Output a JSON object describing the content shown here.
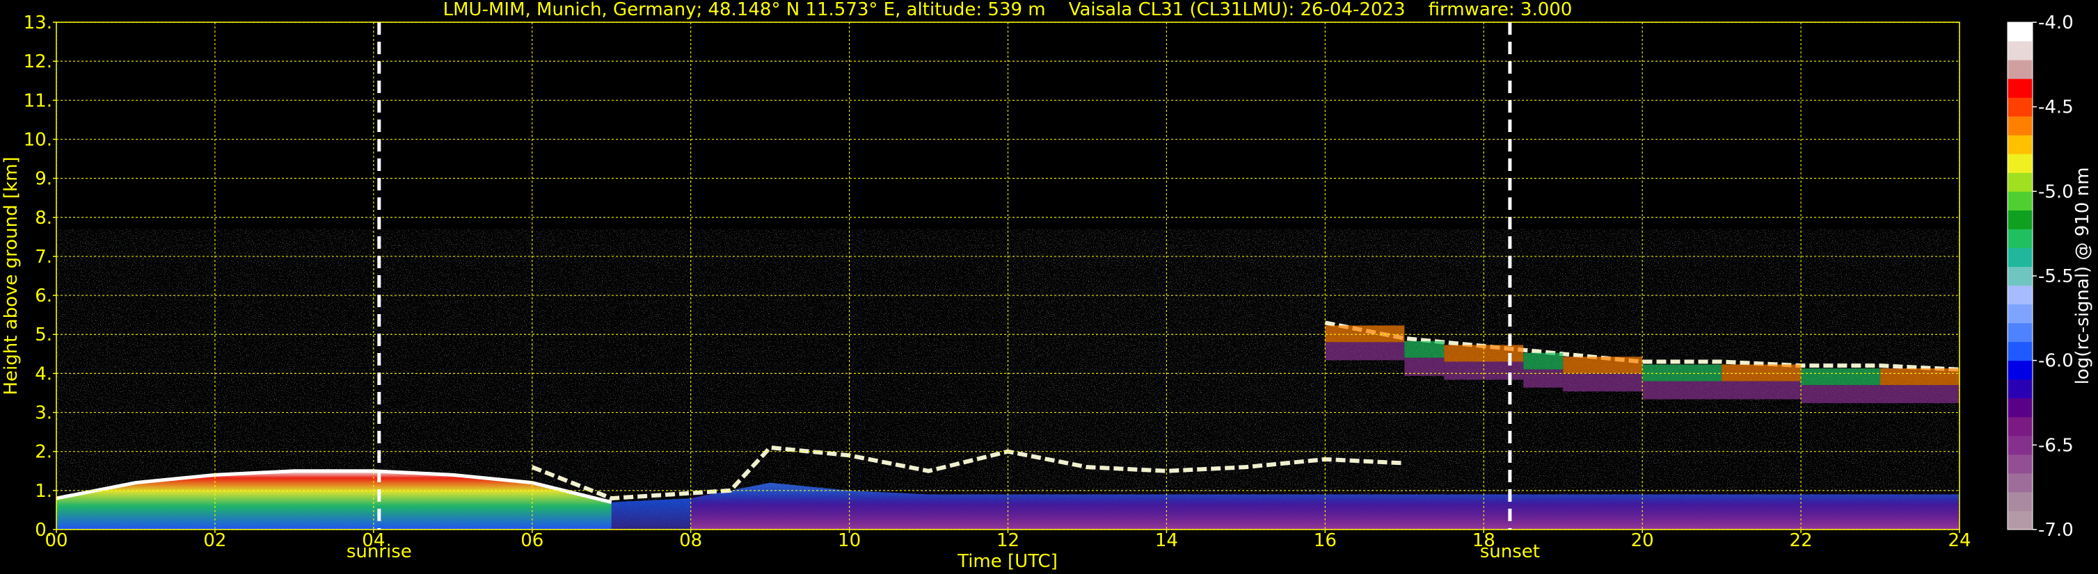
{
  "chart_data": {
    "type": "heatmap",
    "title": "LMU-MIM, Munich, Germany; 48.148° N 11.573° E, altitude: 539 m    Vaisala CL31 (CL31LMU): 26-04-2023    firmware: 3.000",
    "xlabel": "Time [UTC]",
    "ylabel": "Height above ground [km]",
    "xlim": [
      0,
      24
    ],
    "ylim": [
      0,
      13
    ],
    "x_ticks": [
      "00",
      "02",
      "04",
      "06",
      "08",
      "10",
      "12",
      "14",
      "16",
      "18",
      "20",
      "22",
      "24"
    ],
    "y_ticks": [
      "0.",
      "1.",
      "2.",
      "3.",
      "4.",
      "5.",
      "6.",
      "7.",
      "8.",
      "9.",
      "10.",
      "11.",
      "12.",
      "13."
    ],
    "grid": true,
    "events": [
      {
        "label": "sunrise",
        "time": 4.07
      },
      {
        "label": "sunset",
        "time": 18.33
      }
    ],
    "noise_top_km": 7.7,
    "colorbar": {
      "label": "log(rc-signal) @ 910 nm",
      "range": [
        -7.0,
        -4.0
      ],
      "ticks": [
        "-4.0",
        "-4.5",
        "-5.0",
        "-5.5",
        "-6.0",
        "-6.5",
        "-7.0"
      ],
      "colors": [
        "#b49aa6",
        "#aa8aa0",
        "#9e6d9a",
        "#924f94",
        "#86308e",
        "#7a1a82",
        "#5a0088",
        "#2a00b4",
        "#0000e6",
        "#1e5aff",
        "#4e82ff",
        "#7ea4ff",
        "#a6bcff",
        "#6fc5c0",
        "#1fb89c",
        "#20c060",
        "#10a020",
        "#50d030",
        "#a0e020",
        "#f0f020",
        "#ffc000",
        "#ff8000",
        "#ff4000",
        "#ff0000",
        "#d0a0a0",
        "#e8d8d8",
        "#ffffff"
      ]
    },
    "layers": [
      {
        "name": "boundary-layer aerosol",
        "x": [
          0,
          1,
          2,
          3,
          4,
          5,
          6,
          7,
          8,
          9,
          10,
          11,
          12,
          13,
          14,
          15,
          16,
          17,
          18,
          19,
          20,
          21,
          22,
          23,
          24
        ],
        "top_km": [
          0.8,
          1.2,
          1.4,
          1.5,
          1.5,
          1.4,
          1.2,
          0.7,
          0.8,
          1.2,
          1.0,
          0.9,
          0.9,
          0.9,
          0.9,
          0.9,
          0.9,
          0.9,
          0.9,
          0.9,
          0.9,
          0.9,
          0.9,
          0.9,
          0.9
        ]
      },
      {
        "name": "low cloud",
        "x": [
          6.0,
          7.0,
          8.5,
          9.0,
          10.0,
          11.0,
          12.0,
          13.0,
          14.0,
          15.0,
          16.0,
          17.0
        ],
        "top_km": [
          1.6,
          0.8,
          1.0,
          2.1,
          1.9,
          1.5,
          2.0,
          1.6,
          1.5,
          1.6,
          1.8,
          1.7
        ]
      },
      {
        "name": "mid cloud",
        "x": [
          16.0,
          17.0,
          17.5,
          18.5,
          19.0,
          20.0,
          21.0,
          22.0,
          23.0,
          24.0
        ],
        "top_km": [
          5.3,
          4.9,
          4.8,
          4.6,
          4.5,
          4.3,
          4.3,
          4.2,
          4.2,
          4.1
        ]
      }
    ]
  }
}
